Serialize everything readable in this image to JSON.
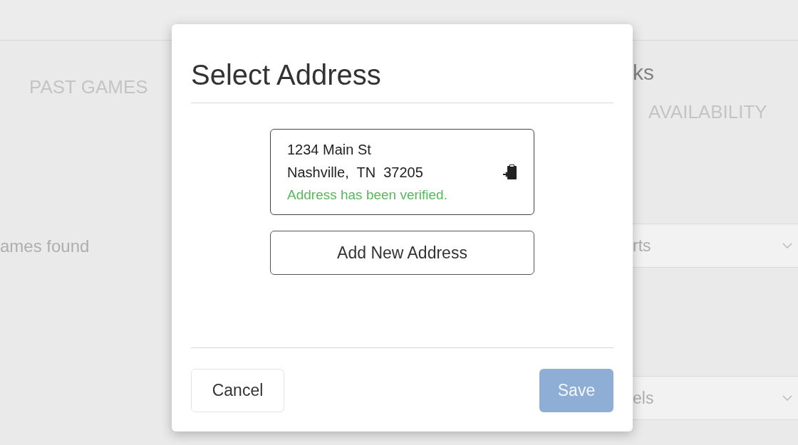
{
  "background": {
    "tab_left": "PAST GAMES",
    "result_text": "ames found",
    "heading_right": "ks",
    "tab_right": "AVAILABILITY",
    "dropdowns": [
      {
        "value": "rts"
      },
      {
        "value": "els"
      }
    ]
  },
  "dialog": {
    "title": "Select Address",
    "addresses": [
      {
        "line1": "1234 Main St",
        "line2": "Nashville,  TN  37205",
        "status": "Address has been verified.",
        "verified": true
      }
    ],
    "add_button": "Add New Address",
    "cancel_button": "Cancel",
    "save_button": {
      "label": "Save",
      "disabled": true
    }
  }
}
